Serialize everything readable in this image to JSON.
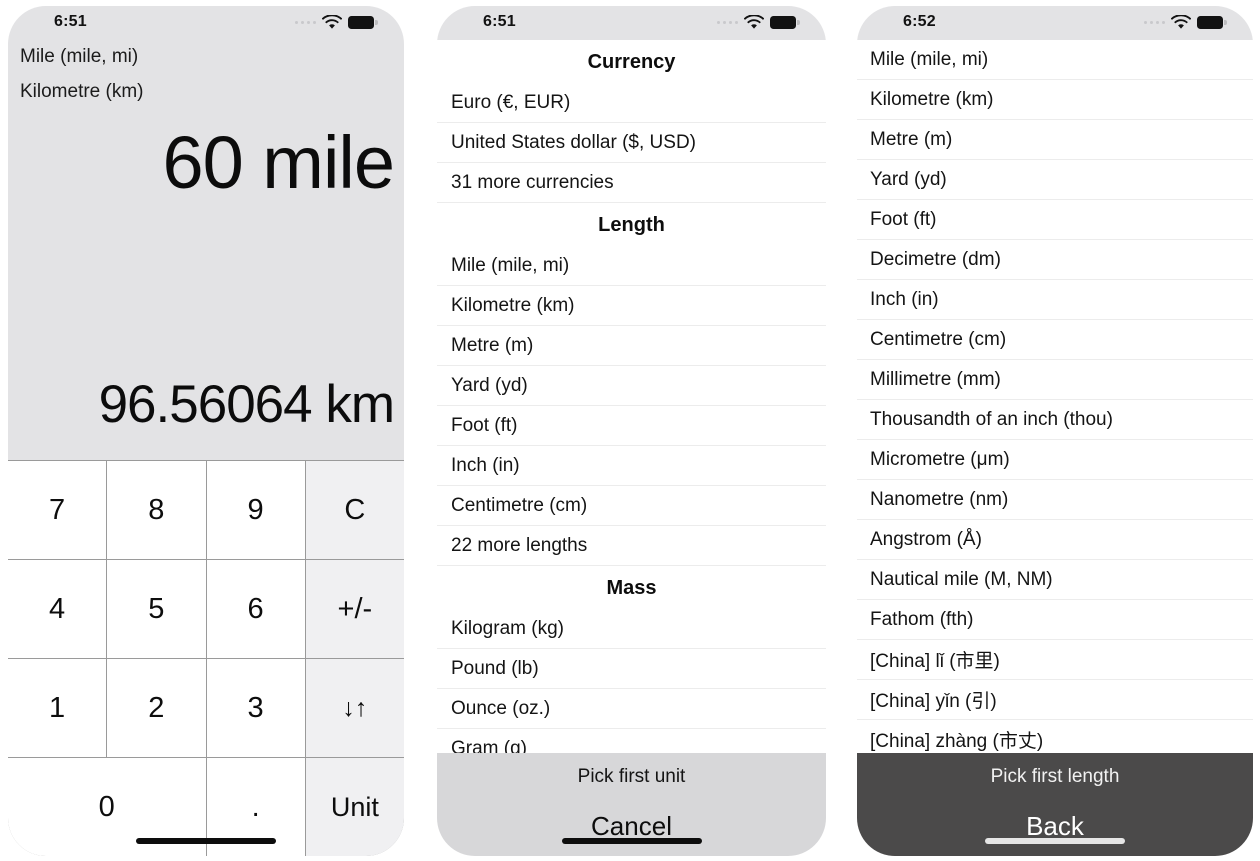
{
  "screen1": {
    "status": {
      "time": "6:51",
      "wifi_icon": "wifi-icon",
      "battery_icon": "battery-icon",
      "signal_icon": "signal-dots-icon"
    },
    "from_unit_label": "Mile (mile, mi)",
    "to_unit_label": "Kilometre (km)",
    "input_value": "60 mile",
    "result_value": "96.56064 km",
    "keys": [
      {
        "label": "7",
        "kind": "digit",
        "name": "key-7"
      },
      {
        "label": "8",
        "kind": "digit",
        "name": "key-8"
      },
      {
        "label": "9",
        "kind": "digit",
        "name": "key-9"
      },
      {
        "label": "C",
        "kind": "fn",
        "name": "key-clear"
      },
      {
        "label": "4",
        "kind": "digit",
        "name": "key-4"
      },
      {
        "label": "5",
        "kind": "digit",
        "name": "key-5"
      },
      {
        "label": "6",
        "kind": "digit",
        "name": "key-6"
      },
      {
        "label": "+/-",
        "kind": "fn",
        "name": "key-sign-toggle"
      },
      {
        "label": "1",
        "kind": "digit",
        "name": "key-1"
      },
      {
        "label": "2",
        "kind": "digit",
        "name": "key-2"
      },
      {
        "label": "3",
        "kind": "digit",
        "name": "key-3"
      },
      {
        "label": "↓↑",
        "kind": "fn",
        "name": "key-swap-units"
      },
      {
        "label": "0",
        "kind": "digit-wide",
        "name": "key-0"
      },
      {
        "label": ".",
        "kind": "digit",
        "name": "key-decimal"
      },
      {
        "label": "Unit",
        "kind": "fn",
        "name": "key-unit"
      }
    ]
  },
  "screen2": {
    "status": {
      "time": "6:51",
      "wifi_icon": "wifi-icon",
      "battery_icon": "battery-icon",
      "signal_icon": "signal-dots-icon"
    },
    "sections": [
      {
        "title": "Currency",
        "items": [
          "Euro (€, EUR)",
          "United States dollar ($, USD)",
          "31 more currencies"
        ]
      },
      {
        "title": "Length",
        "items": [
          "Mile (mile, mi)",
          "Kilometre (km)",
          "Metre (m)",
          "Yard (yd)",
          "Foot (ft)",
          "Inch (in)",
          "Centimetre (cm)",
          "22 more lengths"
        ]
      },
      {
        "title": "Mass",
        "items": [
          "Kilogram (kg)",
          "Pound (lb)",
          "Ounce (oz.)",
          "Gram (g)"
        ]
      }
    ],
    "actionbar": {
      "title": "Pick first unit",
      "button": "Cancel",
      "theme": "light"
    }
  },
  "screen3": {
    "status": {
      "time": "6:52",
      "wifi_icon": "wifi-icon",
      "battery_icon": "battery-icon",
      "signal_icon": "signal-dots-icon"
    },
    "items": [
      "Mile (mile, mi)",
      "Kilometre (km)",
      "Metre (m)",
      "Yard (yd)",
      "Foot (ft)",
      "Decimetre (dm)",
      "Inch (in)",
      "Centimetre (cm)",
      "Millimetre (mm)",
      "Thousandth of an inch (thou)",
      "Micrometre (μm)",
      "Nanometre (nm)",
      "Angstrom (Å)",
      "Nautical mile (M, NM)",
      "Fathom (fth)",
      "[China] lǐ (市里)",
      "[China] yǐn (引)",
      "[China] zhàng (市丈)"
    ],
    "actionbar": {
      "title": "Pick first length",
      "button": "Back",
      "theme": "dark"
    }
  },
  "colors": {
    "display_bg": "#e3e3e5",
    "keypad_fn_bg": "#f0f0f2",
    "actionbar_light": "#d7d7d9",
    "actionbar_dark": "#4b4a4a",
    "text": "#0d0d0d"
  }
}
